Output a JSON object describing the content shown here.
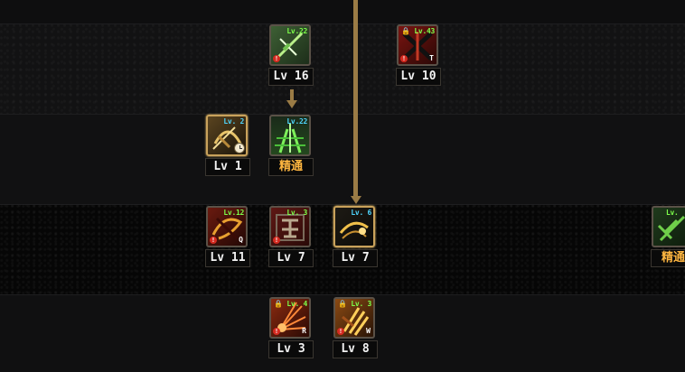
{
  "skills": [
    {
      "id": "s1",
      "tag": "Lv.22",
      "tag_color": "green",
      "level": "Lv 16",
      "warn": "!",
      "key": "",
      "lock": false,
      "clock": false,
      "selected": false,
      "theme": "green-sword"
    },
    {
      "id": "s2",
      "tag": "Lv.43",
      "tag_color": "green",
      "level": "Lv 10",
      "warn": "!",
      "key": "T",
      "lock": true,
      "clock": false,
      "selected": false,
      "theme": "red-cross"
    },
    {
      "id": "s3",
      "tag": "Lv. 2",
      "tag_color": "cyan",
      "level": "Lv 1",
      "warn": "",
      "key": "",
      "lock": false,
      "clock": true,
      "selected": true,
      "theme": "gold-bow"
    },
    {
      "id": "s4",
      "tag": "Lv.22",
      "tag_color": "cyan",
      "level": "精通",
      "mastery": true,
      "warn": "",
      "key": "",
      "lock": false,
      "clock": false,
      "selected": false,
      "theme": "green-road"
    },
    {
      "id": "s5",
      "tag": "Lv.12",
      "tag_color": "green",
      "level": "Lv 11",
      "warn": "!",
      "key": "Q",
      "lock": false,
      "clock": false,
      "selected": false,
      "theme": "red-whip"
    },
    {
      "id": "s6",
      "tag": "Lv. 3",
      "tag_color": "green",
      "level": "Lv 7",
      "warn": "!",
      "key": "",
      "lock": false,
      "clock": false,
      "selected": false,
      "theme": "red-kanji"
    },
    {
      "id": "s7",
      "tag": "Lv. 6",
      "tag_color": "cyan",
      "level": "Lv 7",
      "warn": "",
      "key": "",
      "lock": false,
      "clock": false,
      "selected": true,
      "theme": "gold-dash"
    },
    {
      "id": "s8",
      "tag": "Lv.",
      "tag_color": "green",
      "level": "精通",
      "mastery": true,
      "warn": "",
      "key": "",
      "lock": false,
      "clock": false,
      "selected": false,
      "theme": "green-leaf"
    },
    {
      "id": "s9",
      "tag": "Lv. 4",
      "tag_color": "green",
      "level": "Lv 3",
      "warn": "!",
      "key": "R",
      "lock": true,
      "clock": false,
      "selected": false,
      "theme": "orange-burst"
    },
    {
      "id": "s10",
      "tag": "Lv. 3",
      "tag_color": "green",
      "level": "Lv 8",
      "warn": "!",
      "key": "W",
      "lock": true,
      "clock": false,
      "selected": false,
      "theme": "orange-claw"
    }
  ],
  "colors": {
    "connector": "#9a7b45",
    "frame_selected": "#c9a25b",
    "mastery_text": "#ffb640"
  }
}
